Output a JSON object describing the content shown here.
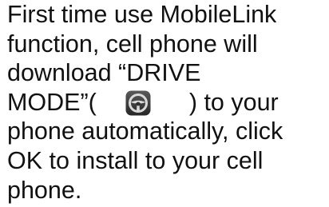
{
  "instruction": {
    "line1": "First time use MobileLink",
    "line2": "function, cell phone will",
    "line3": "download “DRIVE",
    "line4_before": "MODE”(",
    "line4_after": ") to your",
    "line5": "phone automatically, click",
    "line6": "OK to install to your cell",
    "line7": "phone.",
    "drive_mode_icon": "steering-wheel-app-icon"
  },
  "colors": {
    "text": "#111111",
    "icon_background": "#3b3b3b",
    "icon_wheel": "#d9d9d9"
  }
}
